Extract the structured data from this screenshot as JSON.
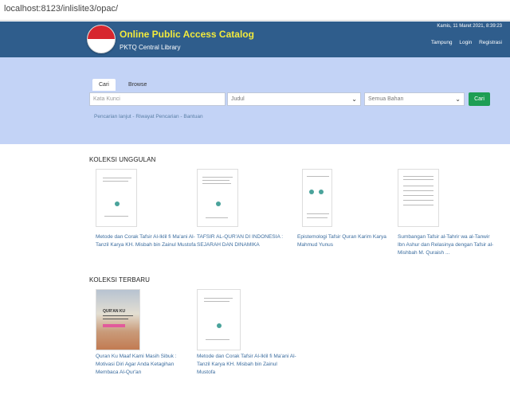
{
  "browser": {
    "url": "localhost:8123/inlislite3/opac/"
  },
  "header": {
    "title": "Online Public Access Catalog",
    "subtitle": "PKTQ Central Library",
    "datetime": "Kamis, 11 Maret 2021, 8:39:23",
    "links": [
      "Tampung",
      "Login",
      "Registrasi"
    ]
  },
  "search": {
    "tabs": [
      "Cari",
      "Browse"
    ],
    "keyword_placeholder": "Kata Kunci",
    "field_select": "Judul",
    "material_select": "Semua Bahan",
    "button": "Cari",
    "advanced_links": "Pencarian lanjut - Riwayat Pencarian - Bantuan"
  },
  "featured": {
    "title": "KOLEKSI UNGGULAN",
    "items": [
      {
        "caption": "Metode dan Corak Tafsir Al-Iklil fi Ma'ani Al-Tanzil Karya KH. Misbah bin Zainul Mustofa"
      },
      {
        "caption": "TAFSIR AL-QUR'AN DI INDONESIA : SEJARAH DAN DINAMIKA"
      },
      {
        "caption": "Epistemologi Tafsir Quran Karim Karya Mahmud Yunus"
      },
      {
        "caption": "Sumbangan Tafsir al-Tahrir wa al-Tanwir Ibn Ashur dan Relasinya dengan Tafsir al-Mishbah M. Quraish ..."
      }
    ]
  },
  "newest": {
    "title": "KOLEKSI TERBARU",
    "items": [
      {
        "caption": "Quran Ku Maaf Kami Masih Sibuk : Motivasi Diri Agar Anda Ketagihan Membaca Al-Qur'an",
        "cover_text": "QUR'AN KU"
      },
      {
        "caption": "Metode dan Corak Tafsir Al-Iklil fi Ma'ani Al-Tanzil Karya KH. Misbah bin Zainul Mustofa"
      }
    ]
  },
  "colors": {
    "header_bg": "#2f5d8c",
    "search_band": "#c3d3f6",
    "title_yellow": "#f2ea3c",
    "button_green": "#1e9e54",
    "link_blue": "#3b6c9e"
  }
}
